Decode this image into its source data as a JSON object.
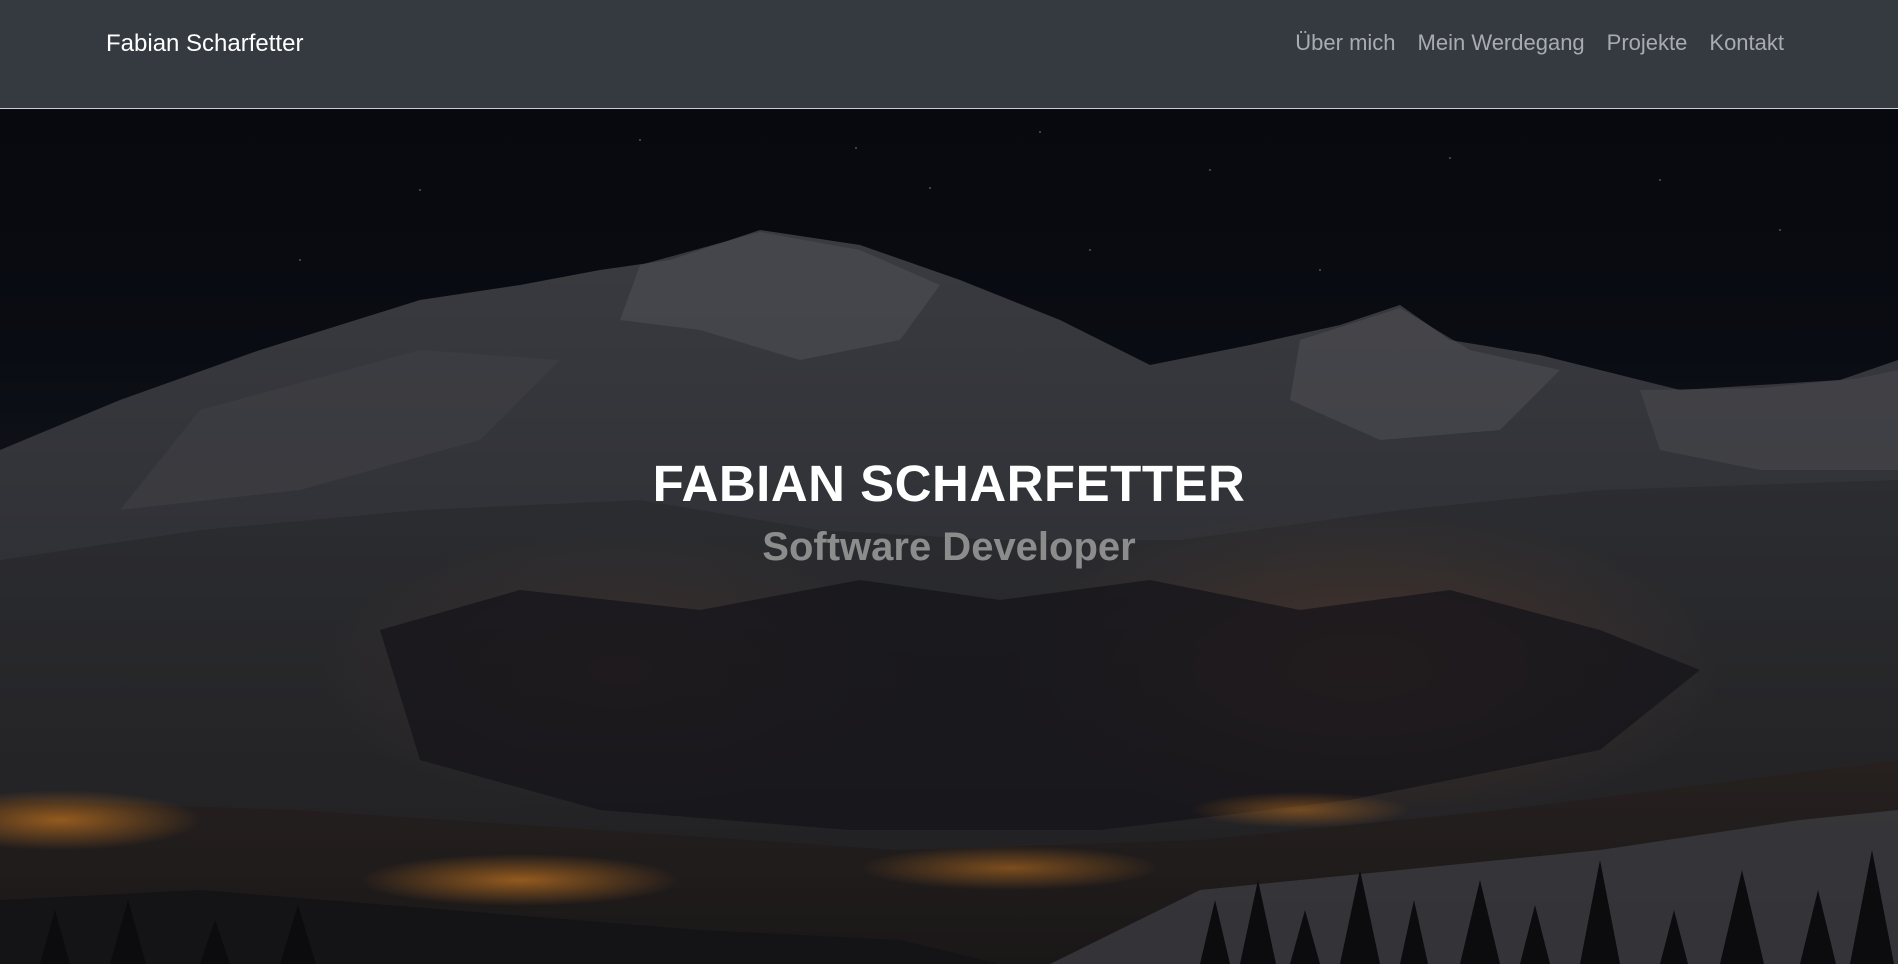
{
  "navbar": {
    "brand": "Fabian Scharfetter",
    "links": [
      {
        "label": "Über mich"
      },
      {
        "label": "Mein Werdegang"
      },
      {
        "label": "Projekte"
      },
      {
        "label": "Kontakt"
      }
    ]
  },
  "hero": {
    "title": "FABIAN SCHARFETTER",
    "subtitle": "Software Developer",
    "background": "night-mountain-landscape-image"
  },
  "colors": {
    "navbar_bg": "#343a40",
    "nav_link": "#a8acb1",
    "brand": "#ffffff",
    "title": "#ffffff",
    "subtitle": "#8c8c8d"
  }
}
